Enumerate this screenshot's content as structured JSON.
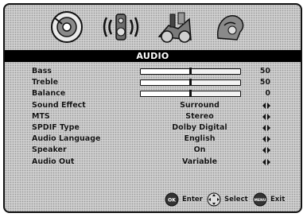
{
  "title": "AUDIO",
  "tabs": [
    {
      "name": "picture-tab-icon"
    },
    {
      "name": "audio-tab-icon"
    },
    {
      "name": "setup-tab-icon"
    },
    {
      "name": "parental-tab-icon"
    }
  ],
  "rows": [
    {
      "label": "Bass",
      "type": "slider",
      "value": "50",
      "level": 0.5
    },
    {
      "label": "Treble",
      "type": "slider",
      "value": "50",
      "level": 0.5
    },
    {
      "label": "Balance",
      "type": "slider",
      "value": "0",
      "level": 0.5
    },
    {
      "label": "Sound Effect",
      "type": "option",
      "value": "Surround"
    },
    {
      "label": "MTS",
      "type": "option",
      "value": "Stereo"
    },
    {
      "label": "SPDIF Type",
      "type": "option",
      "value": "Dolby Digital"
    },
    {
      "label": "Audio Language",
      "type": "option",
      "value": "English"
    },
    {
      "label": "Speaker",
      "type": "option",
      "value": "On"
    },
    {
      "label": "Audio Out",
      "type": "option",
      "value": "Variable"
    }
  ],
  "footer": {
    "ok_button": "OK",
    "enter_label": "Enter",
    "select_label": "Select",
    "menu_button": "MENU",
    "exit_label": "Exit"
  }
}
